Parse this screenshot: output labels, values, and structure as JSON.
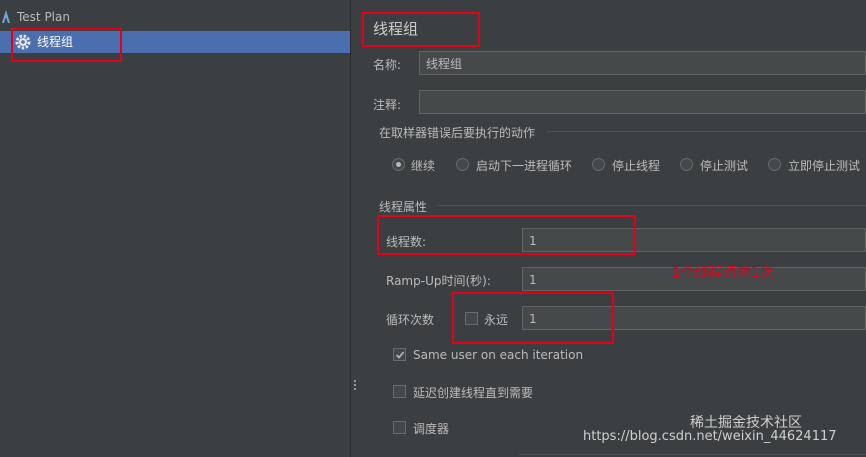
{
  "tree": {
    "test_plan_label": "Test Plan",
    "thread_group_label": "线程组"
  },
  "panel": {
    "title": "线程组",
    "name_label": "名称:",
    "name_value": "线程组",
    "comment_label": "注释:",
    "comment_value": "",
    "error_section_title": "在取样器错误后要执行的动作",
    "error_options": [
      "继续",
      "启动下一进程循环",
      "停止线程",
      "停止测试",
      "立即停止测试"
    ],
    "error_selected": "继续",
    "thread_props_title": "线程属性",
    "threads_label": "线程数:",
    "threads_value": "1",
    "rampup_label": "Ramp-Up时间(秒):",
    "rampup_value": "1",
    "loop_label": "循环次数",
    "forever_label": "永远",
    "loop_value": "1",
    "same_user_label": "Same user on each iteration",
    "same_user_checked": true,
    "delay_label": "延迟创建线程直到需要",
    "delay_checked": false,
    "scheduler_label": "调度器",
    "scheduler_checked": false
  },
  "annotation": {
    "text": "1个线程请求1次"
  },
  "watermark": {
    "logo_text": "稀土掘金技术社区",
    "url_text": "https://blog.csdn.net/weixin_44624117"
  },
  "colors": {
    "background": "#3c3f41",
    "selection": "#4b6eaf",
    "highlight_red": "#e3001b"
  }
}
